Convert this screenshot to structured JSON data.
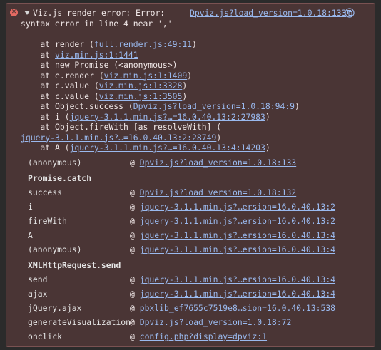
{
  "error": {
    "title_line1": "Viz.js render error: Error:",
    "title_line2": "syntax error in line 4 near ','",
    "source_link": "Dpviz.js?load_version=1.0.18:133"
  },
  "stack": [
    {
      "prefix": "    at render (",
      "link": "full.render.js:49:11",
      "suffix": ")"
    },
    {
      "prefix": "    at ",
      "link": "viz.min.js:1:1441",
      "suffix": ""
    },
    {
      "prefix": "    at new Promise (<anonymous>)",
      "link": "",
      "suffix": ""
    },
    {
      "prefix": "    at e.render (",
      "link": "viz.min.js:1:1409",
      "suffix": ")"
    },
    {
      "prefix": "    at c.value (",
      "link": "viz.min.js:1:3328",
      "suffix": ")"
    },
    {
      "prefix": "    at c.value (",
      "link": "viz.min.js:1:3505",
      "suffix": ")"
    },
    {
      "prefix": "    at Object.success (",
      "link": "Dpviz.js?load_version=1.0.18:94:9",
      "suffix": ")"
    },
    {
      "prefix": "    at i (",
      "link": "jquery-3.1.1.min.js?…=16.0.40.13:2:27983",
      "suffix": ")"
    },
    {
      "prefix": "    at Object.fireWith [as resolveWith] (",
      "link": "",
      "suffix": ""
    },
    {
      "prefix": "",
      "link": "jquery-3.1.1.min.js?…=16.0.40.13:2:28749",
      "suffix": ")"
    },
    {
      "prefix": "    at A (",
      "link": "jquery-3.1.1.min.js?…=16.0.40.13:4:14203",
      "suffix": ")"
    }
  ],
  "async_frames": [
    {
      "type": "frame",
      "fn": "(anonymous)",
      "link": "Dpviz.js?load_version=1.0.18:133"
    },
    {
      "type": "header",
      "label": "Promise.catch"
    },
    {
      "type": "frame",
      "fn": "success",
      "link": "Dpviz.js?load_version=1.0.18:132"
    },
    {
      "type": "frame",
      "fn": "i",
      "link": "jquery-3.1.1.min.js?…ersion=16.0.40.13:2"
    },
    {
      "type": "frame",
      "fn": "fireWith",
      "link": "jquery-3.1.1.min.js?…ersion=16.0.40.13:2"
    },
    {
      "type": "frame",
      "fn": "A",
      "link": "jquery-3.1.1.min.js?…ersion=16.0.40.13:4"
    },
    {
      "type": "frame",
      "fn": "(anonymous)",
      "link": "jquery-3.1.1.min.js?…ersion=16.0.40.13:4"
    },
    {
      "type": "header",
      "label": "XMLHttpRequest.send"
    },
    {
      "type": "frame",
      "fn": "send",
      "link": "jquery-3.1.1.min.js?…ersion=16.0.40.13:4"
    },
    {
      "type": "frame",
      "fn": "ajax",
      "link": "jquery-3.1.1.min.js?…ersion=16.0.40.13:4"
    },
    {
      "type": "frame",
      "fn": "jQuery.ajax",
      "link": "pbxlib_ef7655c7519e8…sion=16.0.40.13:538"
    },
    {
      "type": "frame",
      "fn": "generateVisualization",
      "link": "Dpviz.js?load_version=1.0.18:72"
    },
    {
      "type": "frame",
      "fn": "onclick",
      "link": "config.php?display=dpviz:1"
    }
  ],
  "at_symbol": "@",
  "icons": {
    "error": "error-circle-icon",
    "expand": "expand-triangle-icon",
    "copy": "copy-icon"
  },
  "colors": {
    "panel_bg": "#4a3535",
    "link": "#9ab9ee",
    "error_icon": "#e46a62"
  }
}
